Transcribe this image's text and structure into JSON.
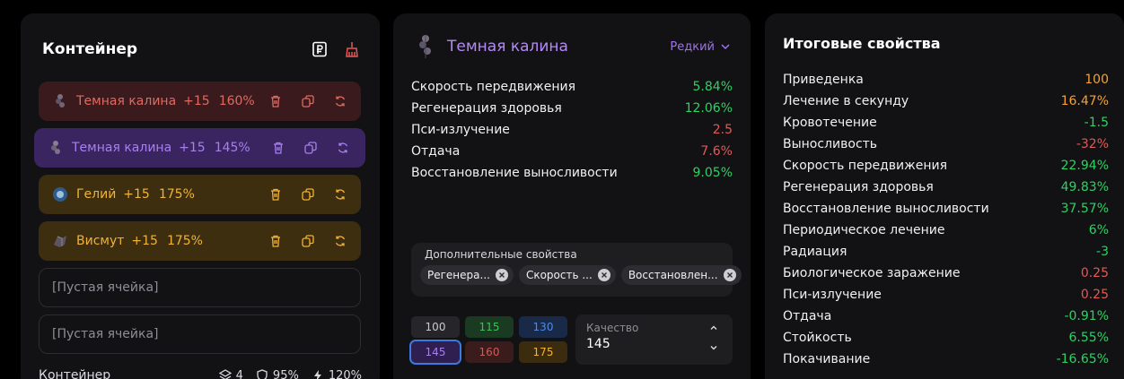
{
  "container": {
    "title": "Контейнер",
    "slots": [
      {
        "name": "Темная калина",
        "level": "+15",
        "quality": "160%",
        "style": "red"
      },
      {
        "name": "Темная калина",
        "level": "+15",
        "quality": "145%",
        "style": "purple"
      },
      {
        "name": "Гелий",
        "level": "+15",
        "quality": "175%",
        "style": "gold"
      },
      {
        "name": "Висмут",
        "level": "+15",
        "quality": "175%",
        "style": "gold"
      }
    ],
    "empty_slot_label": "[Пустая ячейка]",
    "footer": {
      "label": "Контейнер",
      "slots": "4",
      "protection": "95%",
      "speed": "120%"
    }
  },
  "artifact": {
    "name": "Темная калина",
    "rarity": "Редкий",
    "properties": [
      {
        "label": "Скорость передвижения",
        "value": "5.84%",
        "color": "green"
      },
      {
        "label": "Регенерация здоровья",
        "value": "12.06%",
        "color": "green"
      },
      {
        "label": "Пси-излучение",
        "value": "2.5",
        "color": "red"
      },
      {
        "label": "Отдача",
        "value": "7.6%",
        "color": "red"
      },
      {
        "label": "Восстановление выносливости",
        "value": "9.05%",
        "color": "green"
      }
    ],
    "extra_title": "Дополнительные свойства",
    "extra_chips": [
      "Регенера...",
      "Скорость ...",
      "Восстановлен..."
    ],
    "quality_buttons": [
      "100",
      "115",
      "130",
      "145",
      "160",
      "175"
    ],
    "quality_label": "Качество",
    "quality_value": "145"
  },
  "totals": {
    "title": "Итоговые свойства",
    "rows": [
      {
        "label": "Приведенка",
        "value": "100",
        "color": "orange"
      },
      {
        "label": "Лечение в секунду",
        "value": "16.47%",
        "color": "orange"
      },
      {
        "label": "Кровотечение",
        "value": "-1.5",
        "color": "green"
      },
      {
        "label": "Выносливость",
        "value": "-32%",
        "color": "red"
      },
      {
        "label": "Скорость передвижения",
        "value": "22.94%",
        "color": "green"
      },
      {
        "label": "Регенерация здоровья",
        "value": "49.83%",
        "color": "green"
      },
      {
        "label": "Восстановление выносливости",
        "value": "37.57%",
        "color": "green"
      },
      {
        "label": "Периодическое лечение",
        "value": "6%",
        "color": "green"
      },
      {
        "label": "Радиация",
        "value": "-3",
        "color": "green"
      },
      {
        "label": "Биологическое заражение",
        "value": "0.25",
        "color": "red"
      },
      {
        "label": "Пси-излучение",
        "value": "0.25",
        "color": "red"
      },
      {
        "label": "Отдача",
        "value": "-0.91%",
        "color": "green"
      },
      {
        "label": "Стойкость",
        "value": "6.55%",
        "color": "green"
      },
      {
        "label": "Покачивание",
        "value": "-16.65%",
        "color": "green"
      }
    ]
  },
  "colors": {
    "green": "#2fd064",
    "red": "#e05a57",
    "orange": "#f4a233",
    "purple": "#b48af5",
    "gold": "#f2b233"
  }
}
